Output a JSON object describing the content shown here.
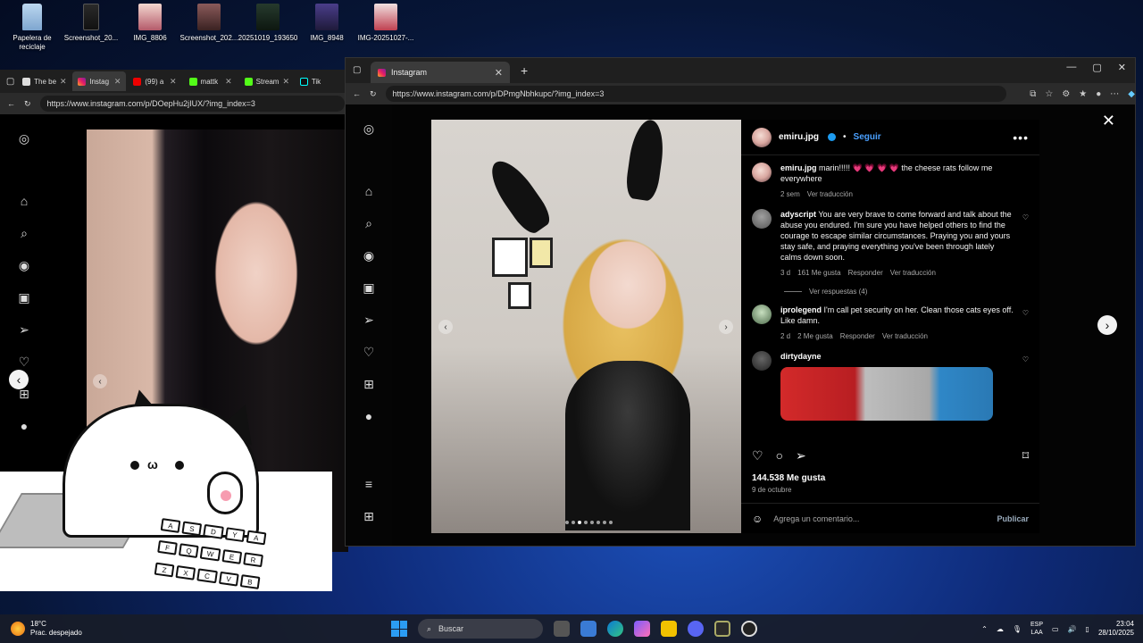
{
  "desktop": {
    "icons": [
      {
        "label": "Papelera de reciclaje",
        "icon": "recycle-bin-icon"
      },
      {
        "label": "Screenshot_20...",
        "icon": "image-file-icon"
      },
      {
        "label": "IMG_8806",
        "icon": "image-file-icon"
      },
      {
        "label": "Screenshot_202...",
        "icon": "image-file-icon"
      },
      {
        "label": "20251019_193650",
        "icon": "image-file-icon"
      },
      {
        "label": "IMG_8948",
        "icon": "image-file-icon"
      },
      {
        "label": "IMG-20251027-...",
        "icon": "image-file-icon"
      }
    ]
  },
  "left_browser": {
    "tabs": [
      {
        "label": "The be",
        "active": false
      },
      {
        "label": "Instag",
        "active": true
      },
      {
        "label": "(99) a",
        "active": false
      },
      {
        "label": "mattk",
        "active": false
      },
      {
        "label": "Stream",
        "active": false
      },
      {
        "label": "Tik",
        "active": false
      }
    ],
    "url": "https://www.instagram.com/p/DOepHu2jIUX/?img_index=3"
  },
  "cat_overlay": {
    "keys": [
      "A",
      "S",
      "D",
      "Y",
      "A",
      "F",
      "Q",
      "W",
      "E",
      "R",
      "Z",
      "X",
      "C",
      "V",
      "B"
    ]
  },
  "right_browser": {
    "tab_title": "Instagram",
    "url": "https://www.instagram.com/p/DPmgNbhkupc/?img_index=3",
    "post": {
      "username": "emiru.jpg",
      "follow_label": "Seguir",
      "more_label": "•••",
      "comments": [
        {
          "user": "emiru.jpg",
          "text": "marin!!!!! 💗 💗 💗 💗 the cheese rats follow me everywhere",
          "time": "2 sem",
          "likes": "",
          "reply": "",
          "translate": "Ver traducción"
        },
        {
          "user": "adyscript",
          "text": "You are very brave to come forward and talk about the abuse you endured. I'm sure you have helped others to find the courage to escape similar circumstances. Praying you and yours stay safe, and praying everything you've been through lately calms down soon.",
          "time": "3 d",
          "likes": "161 Me gusta",
          "reply": "Responder",
          "translate": "Ver traducción"
        },
        {
          "user": "iprolegend",
          "text": "I'm call pet security on her. Clean those cats eyes off. Like damn.",
          "time": "2 d",
          "likes": "2 Me gusta",
          "reply": "Responder",
          "translate": "Ver traducción"
        },
        {
          "user": "dirtydayne",
          "text": "",
          "time": "",
          "likes": "",
          "reply": "",
          "translate": ""
        }
      ],
      "view_replies": "Ver respuestas (4)",
      "likes_total": "144.538 Me gusta",
      "date": "9 de octubre",
      "comment_placeholder": "Agrega un comentario...",
      "publish_label": "Publicar",
      "carousel_index": 3,
      "carousel_total": 8
    }
  },
  "taskbar": {
    "temperature": "18°C",
    "weather": "Prac. despejado",
    "search_label": "Buscar",
    "lang_top": "ESP",
    "lang_bottom": "LAA",
    "time": "23:04",
    "date": "28/10/2025"
  }
}
